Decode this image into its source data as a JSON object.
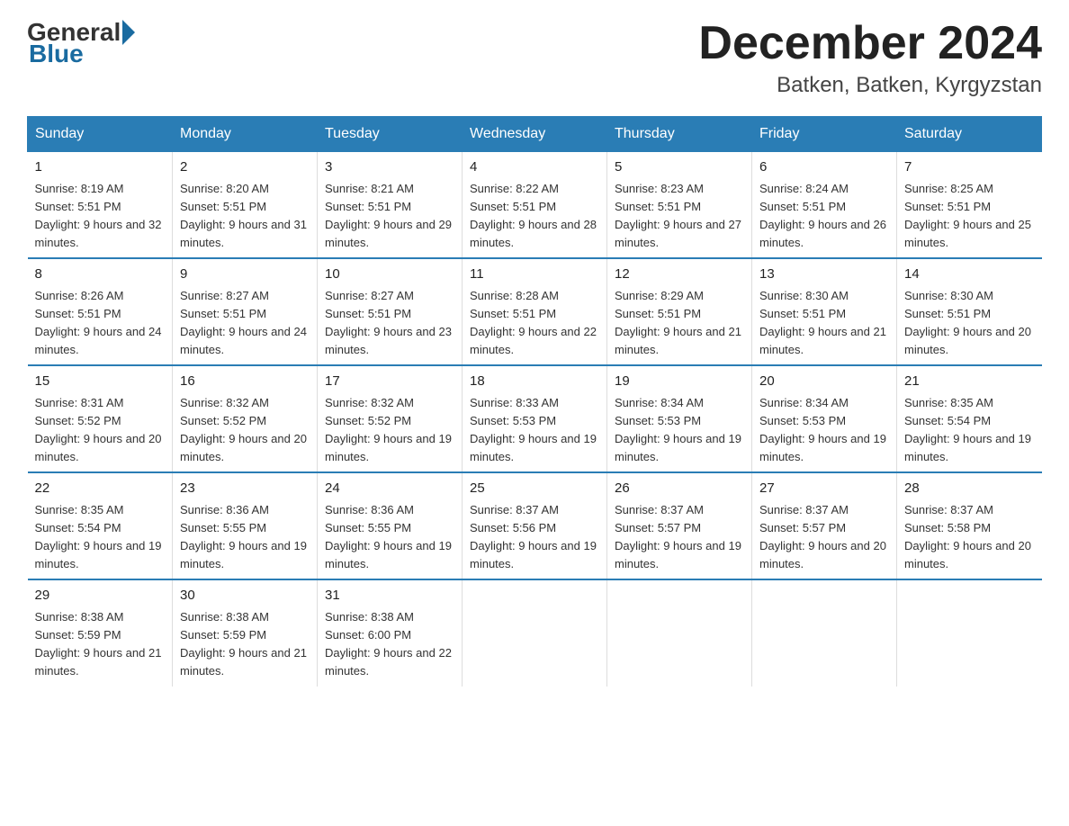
{
  "logo": {
    "general": "General",
    "blue": "Blue"
  },
  "title": "December 2024",
  "location": "Batken, Batken, Kyrgyzstan",
  "days_of_week": [
    "Sunday",
    "Monday",
    "Tuesday",
    "Wednesday",
    "Thursday",
    "Friday",
    "Saturday"
  ],
  "weeks": [
    [
      {
        "day": 1,
        "sunrise": "Sunrise: 8:19 AM",
        "sunset": "Sunset: 5:51 PM",
        "daylight": "Daylight: 9 hours and 32 minutes."
      },
      {
        "day": 2,
        "sunrise": "Sunrise: 8:20 AM",
        "sunset": "Sunset: 5:51 PM",
        "daylight": "Daylight: 9 hours and 31 minutes."
      },
      {
        "day": 3,
        "sunrise": "Sunrise: 8:21 AM",
        "sunset": "Sunset: 5:51 PM",
        "daylight": "Daylight: 9 hours and 29 minutes."
      },
      {
        "day": 4,
        "sunrise": "Sunrise: 8:22 AM",
        "sunset": "Sunset: 5:51 PM",
        "daylight": "Daylight: 9 hours and 28 minutes."
      },
      {
        "day": 5,
        "sunrise": "Sunrise: 8:23 AM",
        "sunset": "Sunset: 5:51 PM",
        "daylight": "Daylight: 9 hours and 27 minutes."
      },
      {
        "day": 6,
        "sunrise": "Sunrise: 8:24 AM",
        "sunset": "Sunset: 5:51 PM",
        "daylight": "Daylight: 9 hours and 26 minutes."
      },
      {
        "day": 7,
        "sunrise": "Sunrise: 8:25 AM",
        "sunset": "Sunset: 5:51 PM",
        "daylight": "Daylight: 9 hours and 25 minutes."
      }
    ],
    [
      {
        "day": 8,
        "sunrise": "Sunrise: 8:26 AM",
        "sunset": "Sunset: 5:51 PM",
        "daylight": "Daylight: 9 hours and 24 minutes."
      },
      {
        "day": 9,
        "sunrise": "Sunrise: 8:27 AM",
        "sunset": "Sunset: 5:51 PM",
        "daylight": "Daylight: 9 hours and 24 minutes."
      },
      {
        "day": 10,
        "sunrise": "Sunrise: 8:27 AM",
        "sunset": "Sunset: 5:51 PM",
        "daylight": "Daylight: 9 hours and 23 minutes."
      },
      {
        "day": 11,
        "sunrise": "Sunrise: 8:28 AM",
        "sunset": "Sunset: 5:51 PM",
        "daylight": "Daylight: 9 hours and 22 minutes."
      },
      {
        "day": 12,
        "sunrise": "Sunrise: 8:29 AM",
        "sunset": "Sunset: 5:51 PM",
        "daylight": "Daylight: 9 hours and 21 minutes."
      },
      {
        "day": 13,
        "sunrise": "Sunrise: 8:30 AM",
        "sunset": "Sunset: 5:51 PM",
        "daylight": "Daylight: 9 hours and 21 minutes."
      },
      {
        "day": 14,
        "sunrise": "Sunrise: 8:30 AM",
        "sunset": "Sunset: 5:51 PM",
        "daylight": "Daylight: 9 hours and 20 minutes."
      }
    ],
    [
      {
        "day": 15,
        "sunrise": "Sunrise: 8:31 AM",
        "sunset": "Sunset: 5:52 PM",
        "daylight": "Daylight: 9 hours and 20 minutes."
      },
      {
        "day": 16,
        "sunrise": "Sunrise: 8:32 AM",
        "sunset": "Sunset: 5:52 PM",
        "daylight": "Daylight: 9 hours and 20 minutes."
      },
      {
        "day": 17,
        "sunrise": "Sunrise: 8:32 AM",
        "sunset": "Sunset: 5:52 PM",
        "daylight": "Daylight: 9 hours and 19 minutes."
      },
      {
        "day": 18,
        "sunrise": "Sunrise: 8:33 AM",
        "sunset": "Sunset: 5:53 PM",
        "daylight": "Daylight: 9 hours and 19 minutes."
      },
      {
        "day": 19,
        "sunrise": "Sunrise: 8:34 AM",
        "sunset": "Sunset: 5:53 PM",
        "daylight": "Daylight: 9 hours and 19 minutes."
      },
      {
        "day": 20,
        "sunrise": "Sunrise: 8:34 AM",
        "sunset": "Sunset: 5:53 PM",
        "daylight": "Daylight: 9 hours and 19 minutes."
      },
      {
        "day": 21,
        "sunrise": "Sunrise: 8:35 AM",
        "sunset": "Sunset: 5:54 PM",
        "daylight": "Daylight: 9 hours and 19 minutes."
      }
    ],
    [
      {
        "day": 22,
        "sunrise": "Sunrise: 8:35 AM",
        "sunset": "Sunset: 5:54 PM",
        "daylight": "Daylight: 9 hours and 19 minutes."
      },
      {
        "day": 23,
        "sunrise": "Sunrise: 8:36 AM",
        "sunset": "Sunset: 5:55 PM",
        "daylight": "Daylight: 9 hours and 19 minutes."
      },
      {
        "day": 24,
        "sunrise": "Sunrise: 8:36 AM",
        "sunset": "Sunset: 5:55 PM",
        "daylight": "Daylight: 9 hours and 19 minutes."
      },
      {
        "day": 25,
        "sunrise": "Sunrise: 8:37 AM",
        "sunset": "Sunset: 5:56 PM",
        "daylight": "Daylight: 9 hours and 19 minutes."
      },
      {
        "day": 26,
        "sunrise": "Sunrise: 8:37 AM",
        "sunset": "Sunset: 5:57 PM",
        "daylight": "Daylight: 9 hours and 19 minutes."
      },
      {
        "day": 27,
        "sunrise": "Sunrise: 8:37 AM",
        "sunset": "Sunset: 5:57 PM",
        "daylight": "Daylight: 9 hours and 20 minutes."
      },
      {
        "day": 28,
        "sunrise": "Sunrise: 8:37 AM",
        "sunset": "Sunset: 5:58 PM",
        "daylight": "Daylight: 9 hours and 20 minutes."
      }
    ],
    [
      {
        "day": 29,
        "sunrise": "Sunrise: 8:38 AM",
        "sunset": "Sunset: 5:59 PM",
        "daylight": "Daylight: 9 hours and 21 minutes."
      },
      {
        "day": 30,
        "sunrise": "Sunrise: 8:38 AM",
        "sunset": "Sunset: 5:59 PM",
        "daylight": "Daylight: 9 hours and 21 minutes."
      },
      {
        "day": 31,
        "sunrise": "Sunrise: 8:38 AM",
        "sunset": "Sunset: 6:00 PM",
        "daylight": "Daylight: 9 hours and 22 minutes."
      },
      null,
      null,
      null,
      null
    ]
  ]
}
